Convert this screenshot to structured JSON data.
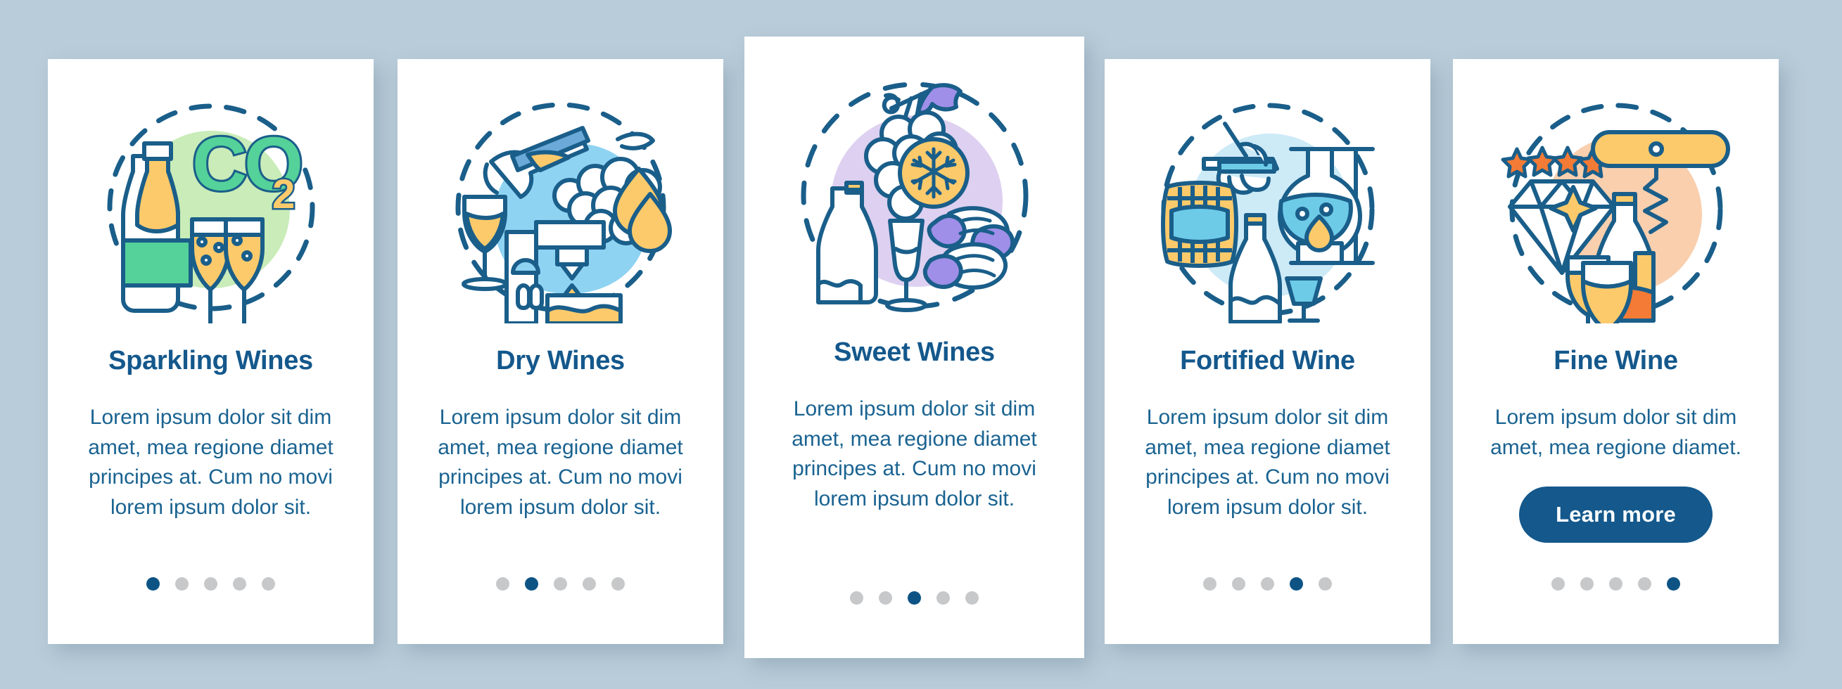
{
  "background_color": "#b9ccd9",
  "theme": {
    "title_color": "#14588c",
    "body_color": "#1a6391",
    "accent_color": "#0d5485",
    "dot_inactive_color": "#c6c8ca",
    "card_background": "#ffffff",
    "outline_color": "#1a5e8a"
  },
  "screen_count": 5,
  "cards": [
    {
      "id": "sparkling-wines",
      "title": "Sparkling Wines",
      "body": "Lorem ipsum dolor sit dim amet, mea regione diamet principes at. Cum no movi lorem ipsum dolor sit.",
      "active_index": 0,
      "has_button": false,
      "illustration": {
        "name": "sparkling-wine-concept-icon",
        "blob_color": "#c9ecb8",
        "elements": [
          "champagne-bottle",
          "co2-label",
          "champagne-glass",
          "champagne-glass",
          "dashed-circle"
        ],
        "co2_text": "CO",
        "co2_subscript": "2",
        "palette": {
          "blob": "#c9ecb8",
          "green": "#55d19a",
          "yellow": "#fcca6b",
          "outline": "#1a5e8a"
        }
      }
    },
    {
      "id": "dry-wines",
      "title": "Dry Wines",
      "body": "Lorem ipsum dolor sit dim amet, mea regione diamet principes at. Cum no movi lorem ipsum dolor sit.",
      "active_index": 1,
      "has_button": false,
      "illustration": {
        "name": "dry-wine-concept-icon",
        "blob_color": "#8ed3f2",
        "elements": [
          "pouring-bottle",
          "wine-glass",
          "grape-bunch",
          "juice-press",
          "dashed-circle"
        ],
        "palette": {
          "blob": "#8ed3f2",
          "yellow": "#fcca6b",
          "blue": "#6aa9d8",
          "outline": "#1a5e8a"
        }
      }
    },
    {
      "id": "sweet-wines",
      "title": "Sweet Wines",
      "body": "Lorem ipsum dolor sit dim amet, mea regione diamet principes at. Cum no movi lorem ipsum dolor sit.",
      "active_index": 2,
      "has_button": false,
      "illustration": {
        "name": "sweet-wine-concept-icon",
        "blob_color": "#ddd0f0",
        "elements": [
          "grape-bunch",
          "snowflake-badge",
          "wine-bottle",
          "champagne-glass",
          "raisins",
          "dashed-circle"
        ],
        "palette": {
          "blob": "#ddd0f0",
          "purple": "#9f8fe8",
          "yellow": "#fcca6b",
          "outline": "#1a5e8a"
        }
      }
    },
    {
      "id": "fortified-wine",
      "title": "Fortified Wine",
      "body": "Lorem ipsum dolor sit dim amet, mea regione diamet principes at. Cum no movi lorem ipsum dolor sit.",
      "active_index": 3,
      "has_button": false,
      "illustration": {
        "name": "fortified-wine-concept-icon",
        "blob_color": "#cdeaf7",
        "elements": [
          "oak-barrel",
          "hand-with-pipette",
          "round-flask",
          "burner-flame",
          "wine-bottle",
          "wine-glass",
          "dashed-circle"
        ],
        "palette": {
          "blob": "#cdeaf7",
          "cyan": "#6ecbe8",
          "yellow": "#fcca6b",
          "outline": "#1a5e8a"
        }
      }
    },
    {
      "id": "fine-wine",
      "title": "Fine Wine",
      "body": "Lorem ipsum dolor sit dim amet, mea regione diamet.",
      "active_index": 4,
      "has_button": true,
      "button_label": "Learn more",
      "illustration": {
        "name": "fine-wine-concept-icon",
        "blob_color": "#f9cfae",
        "star_count": 4,
        "elements": [
          "four-stars",
          "diamond",
          "corkscrew",
          "wine-bottle",
          "wine-glass",
          "wine-glass",
          "dashed-circle"
        ],
        "palette": {
          "blob": "#f9cfae",
          "orange": "#f47b35",
          "yellow": "#fcca6b",
          "outline": "#1a5e8a"
        }
      }
    }
  ]
}
